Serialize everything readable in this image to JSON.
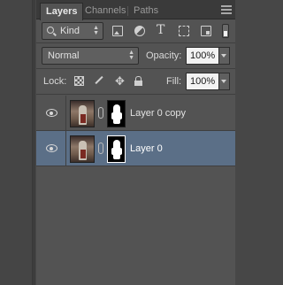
{
  "tabs": [
    {
      "label": "Layers",
      "active": true
    },
    {
      "label": "Channels",
      "active": false
    },
    {
      "label": "Paths",
      "active": false
    }
  ],
  "filter": {
    "kind_label": "Kind",
    "icons": [
      "image-filter-icon",
      "adjustment-filter-icon",
      "type-filter-icon",
      "shape-filter-icon",
      "smart-object-filter-icon"
    ]
  },
  "blend": {
    "mode": "Normal",
    "opacity_label": "Opacity:",
    "opacity_value": "100%"
  },
  "lock": {
    "label": "Lock:",
    "fill_label": "Fill:",
    "fill_value": "100%"
  },
  "layers": [
    {
      "name": "Layer 0 copy",
      "visible": true,
      "selected": false
    },
    {
      "name": "Layer 0",
      "visible": true,
      "selected": true
    }
  ],
  "colors": {
    "panel_bg": "#535353",
    "selected_row": "#5b6f87",
    "tab_bar": "#3a3a3a"
  }
}
